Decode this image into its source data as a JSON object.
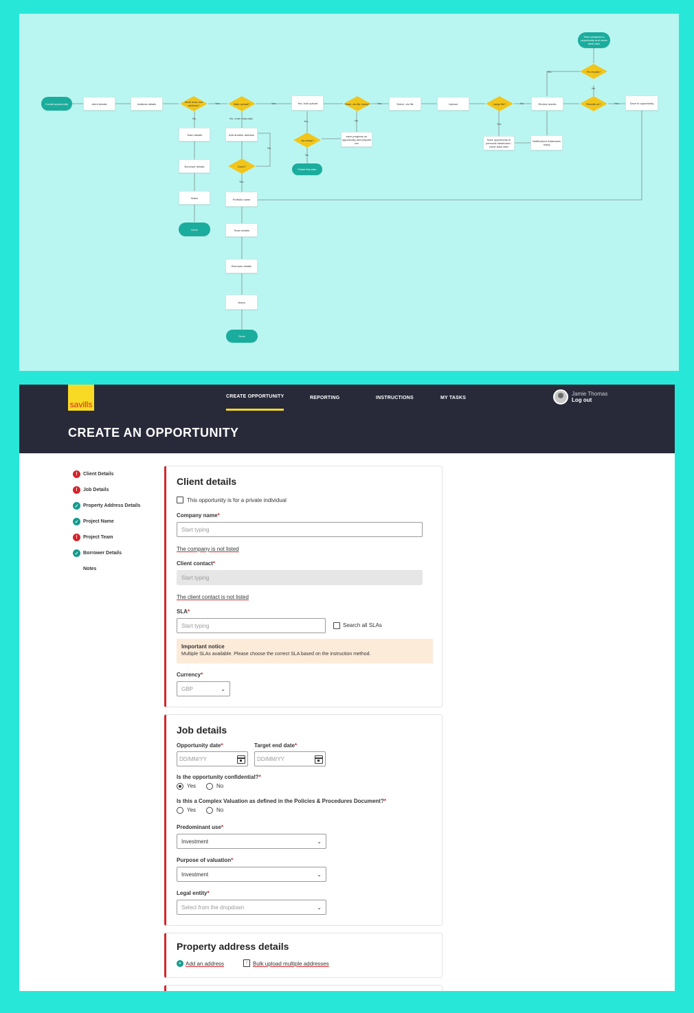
{
  "flowchart": {
    "nodes": {
      "create_opportunity": "Create opportunity",
      "client_details": "client details",
      "address_details": "Address details",
      "more_than_one": "More than one address?",
      "bulk_upload": "Bulk upload?",
      "yes_bulk_upload": "Yes, bulk upload",
      "have_xls": "Have .xls file ready?",
      "select_xls": "Select .xls file",
      "upload": "Upload",
      "large_file": "Large file?",
      "review_results": "Review results",
      "results_ok": "Results ok?",
      "save_to_opportunity": "Save to opportunity",
      "fix_results": "Fix results?",
      "save_progress_top": "Save progress to opportunity and come back later",
      "team_details_1": "Team details",
      "borrower_details_1": "Borrower details",
      "notes_1": "Notes",
      "done_1": "Done",
      "no_enter_manually": "No, enter manually",
      "add_another_address": "Add another address",
      "done_q": "Done?",
      "xls_ready": ".xls ready?",
      "finish_later": "Finish this later",
      "save_progress_csv": "save progress on opportunity and prepare csv",
      "save_to_dashboard": "Save opportunity to personal dashboard - come back later",
      "notification": "Notification! Addresses ready",
      "portfolio_name": "Portfolio name",
      "team_details_2": "Team details",
      "borrower_details_2": "Borrower details",
      "notes_2": "Notes",
      "done_2": "Done"
    },
    "edge_labels": {
      "yes": "Yes",
      "no": "No"
    }
  },
  "topbar": {
    "logo": "savills",
    "nav": [
      "CREATE OPPORTUNITY",
      "REPORTING",
      "INSTRUCTIONS",
      "MY TASKS"
    ],
    "user_name": "Jamie Thomas",
    "logout": "Log out"
  },
  "header": {
    "title": "CREATE AN OPPORTUNITY"
  },
  "sidebar": {
    "steps": [
      {
        "label": "Client Details",
        "status": "error"
      },
      {
        "label": "Job Details",
        "status": "error"
      },
      {
        "label": "Property Address Details",
        "status": "complete"
      },
      {
        "label": "Project Name",
        "status": "complete"
      },
      {
        "label": "Project Team",
        "status": "error"
      },
      {
        "label": "Borrower Details",
        "status": "complete"
      },
      {
        "label": "Notes",
        "status": "none"
      }
    ],
    "icons": {
      "error": "!",
      "complete": "✓"
    }
  },
  "client_details": {
    "title": "Client details",
    "private_individual": "This opportunity is for a private individual",
    "company_name_label": "Company name",
    "company_placeholder": "Start typing",
    "company_not_listed": "The company is not listed",
    "client_contact_label": "Client contact",
    "client_contact_placeholder": "Start typing",
    "client_contact_not_listed": "The client contact is not listed",
    "sla_label": "SLA",
    "sla_placeholder": "Start typing",
    "search_all_slas": "Search all SLAs",
    "notice_title": "Important notice",
    "notice_text": "Multiple SLAs available. Please choose the correct SLA based on the instruction method.",
    "currency_label": "Currency",
    "currency_value": "GBP",
    "required_mark": "*"
  },
  "job_details": {
    "title": "Job details",
    "opportunity_date_label": "Opportunity date",
    "target_end_date_label": "Target end date",
    "date_placeholder": "DD/MM/YY",
    "confidential_label": "Is the opportunity confidential?",
    "complex_label": "Is this a Complex Valuation as defined in the Policies & Procedures Document?",
    "yes": "Yes",
    "no": "No",
    "predominant_use_label": "Predominant use",
    "predominant_use_value": "Investment",
    "purpose_label": "Purpose of valuation",
    "purpose_value": "Investment",
    "legal_entity_label": "Legal entity",
    "legal_entity_placeholder": "Select from the dropdown"
  },
  "property_address": {
    "title": "Property address details",
    "add_address": "Add an address",
    "bulk_upload": "Bulk upload multiple addresses"
  },
  "colors": {
    "accent_yellow": "#f8da24",
    "error_red": "#d6232a",
    "teal": "#159a8c",
    "navy": "#282a3a",
    "background": "#27e8d8"
  }
}
